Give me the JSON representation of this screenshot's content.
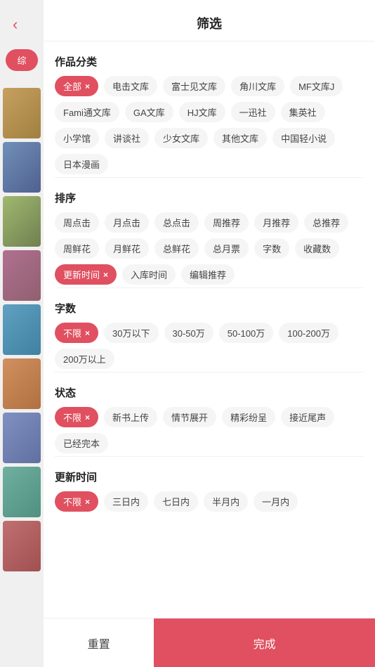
{
  "header": {
    "title": "筛选",
    "back_label": "‹"
  },
  "sidebar": {
    "tab_label": "综",
    "covers": [
      {
        "color": "#c8a060"
      },
      {
        "color": "#7090b8"
      },
      {
        "color": "#a0b870"
      },
      {
        "color": "#b07090"
      },
      {
        "color": "#60a0c0"
      },
      {
        "color": "#d09060"
      },
      {
        "color": "#8090c0"
      },
      {
        "color": "#70b0a0"
      },
      {
        "color": "#c07070"
      }
    ]
  },
  "sections": {
    "category": {
      "title": "作品分类",
      "tags": [
        {
          "label": "全部",
          "active": true,
          "close": true
        },
        {
          "label": "电击文库",
          "active": false
        },
        {
          "label": "富士见文库",
          "active": false
        },
        {
          "label": "角川文库",
          "active": false
        },
        {
          "label": "MF文库J",
          "active": false
        },
        {
          "label": "Fami通文库",
          "active": false
        },
        {
          "label": "GA文库",
          "active": false
        },
        {
          "label": "HJ文库",
          "active": false
        },
        {
          "label": "一迅社",
          "active": false
        },
        {
          "label": "集英社",
          "active": false
        },
        {
          "label": "小学馆",
          "active": false
        },
        {
          "label": "讲谈社",
          "active": false
        },
        {
          "label": "少女文库",
          "active": false
        },
        {
          "label": "其他文库",
          "active": false
        },
        {
          "label": "中国轻小说",
          "active": false
        },
        {
          "label": "日本漫画",
          "active": false
        }
      ]
    },
    "sort": {
      "title": "排序",
      "tags": [
        {
          "label": "周点击",
          "active": false
        },
        {
          "label": "月点击",
          "active": false
        },
        {
          "label": "总点击",
          "active": false
        },
        {
          "label": "周推荐",
          "active": false
        },
        {
          "label": "月推荐",
          "active": false
        },
        {
          "label": "总推荐",
          "active": false
        },
        {
          "label": "周鲜花",
          "active": false
        },
        {
          "label": "月鲜花",
          "active": false
        },
        {
          "label": "总鲜花",
          "active": false
        },
        {
          "label": "总月票",
          "active": false
        },
        {
          "label": "字数",
          "active": false
        },
        {
          "label": "收藏数",
          "active": false
        },
        {
          "label": "更新时间",
          "active": true,
          "close": true
        },
        {
          "label": "入库时间",
          "active": false
        },
        {
          "label": "编辑推荐",
          "active": false
        }
      ]
    },
    "word_count": {
      "title": "字数",
      "tags": [
        {
          "label": "不限",
          "active": true,
          "close": true
        },
        {
          "label": "30万以下",
          "active": false
        },
        {
          "label": "30-50万",
          "active": false
        },
        {
          "label": "50-100万",
          "active": false
        },
        {
          "label": "100-200万",
          "active": false
        },
        {
          "label": "200万以上",
          "active": false
        }
      ]
    },
    "status": {
      "title": "状态",
      "tags": [
        {
          "label": "不限",
          "active": true,
          "close": true
        },
        {
          "label": "新书上传",
          "active": false
        },
        {
          "label": "情节展开",
          "active": false
        },
        {
          "label": "精彩纷呈",
          "active": false
        },
        {
          "label": "接近尾声",
          "active": false
        },
        {
          "label": "已经完本",
          "active": false
        }
      ]
    },
    "update_time": {
      "title": "更新时间",
      "tags": [
        {
          "label": "不限",
          "active": true,
          "close": true
        },
        {
          "label": "三日内",
          "active": false
        },
        {
          "label": "七日内",
          "active": false
        },
        {
          "label": "半月内",
          "active": false
        },
        {
          "label": "一月内",
          "active": false
        }
      ]
    }
  },
  "footer": {
    "reset_label": "重置",
    "confirm_label": "完成"
  }
}
